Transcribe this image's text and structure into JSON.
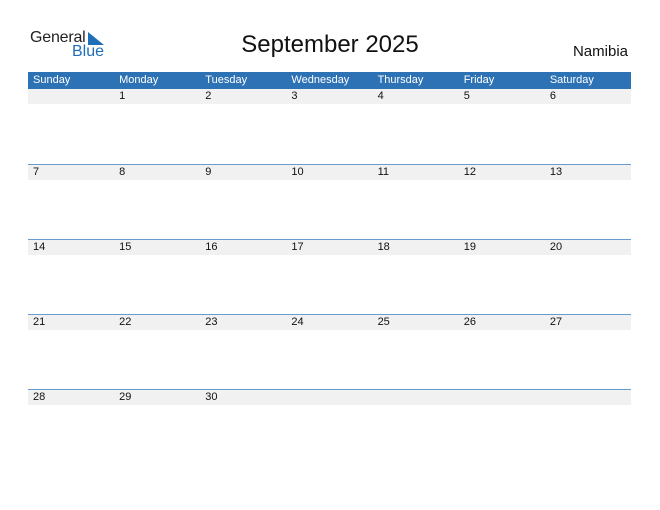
{
  "logo": {
    "line1": "General",
    "line2": "Blue"
  },
  "title": "September 2025",
  "country": "Namibia",
  "weekdays": [
    "Sunday",
    "Monday",
    "Tuesday",
    "Wednesday",
    "Thursday",
    "Friday",
    "Saturday"
  ],
  "weeks": [
    [
      "",
      "1",
      "2",
      "3",
      "4",
      "5",
      "6"
    ],
    [
      "7",
      "8",
      "9",
      "10",
      "11",
      "12",
      "13"
    ],
    [
      "14",
      "15",
      "16",
      "17",
      "18",
      "19",
      "20"
    ],
    [
      "21",
      "22",
      "23",
      "24",
      "25",
      "26",
      "27"
    ],
    [
      "28",
      "29",
      "30",
      "",
      "",
      "",
      ""
    ]
  ],
  "colors": {
    "accent": "#2e72b6",
    "band": "#f1f1f2",
    "separator": "#6a9bcf"
  }
}
